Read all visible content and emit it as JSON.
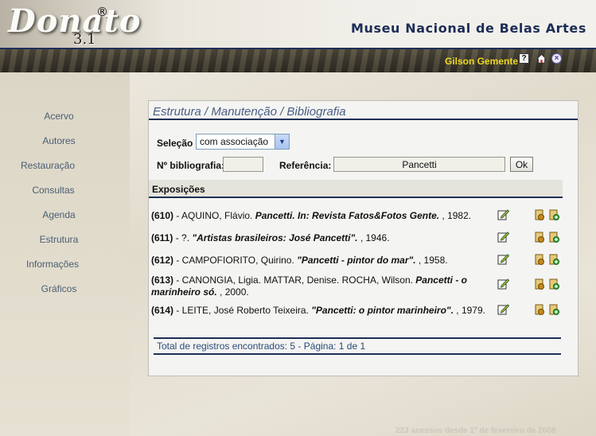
{
  "header": {
    "logo": "Donato",
    "logo_mark": "®",
    "version": "3.1",
    "museum": "Museu Nacional de Belas Artes",
    "user": "Gilson Gemente",
    "icons": [
      "help-icon",
      "home-icon",
      "close-icon"
    ]
  },
  "sidebar": {
    "items": [
      {
        "label": "Acervo"
      },
      {
        "label": "Autores"
      },
      {
        "label": "Restauração"
      },
      {
        "label": "Consultas"
      },
      {
        "label": "Agenda"
      },
      {
        "label": "Estrutura"
      },
      {
        "label": "Informações"
      },
      {
        "label": "Gráficos"
      }
    ]
  },
  "main": {
    "breadcrumb": "Estrutura / Manutenção / Bibliografia",
    "selection": {
      "label": "Seleção",
      "value": "com associação"
    },
    "filters": {
      "bib_label": "Nº bibliografia:",
      "bib_value": "",
      "ref_label": "Referência:",
      "ref_value": "Pancetti",
      "ok": "Ok"
    },
    "section_title": "Exposições",
    "rows": [
      {
        "id": "(610)",
        "pre": " - AQUINO, Flávio. ",
        "title": "Pancetti. In: Revista Fatos&Fotos Gente.",
        "post": " , 1982."
      },
      {
        "id": "(611)",
        "pre": " - ?. ",
        "title": "\"Artistas brasileiros: José Pancetti\".",
        "post": " , 1946."
      },
      {
        "id": "(612)",
        "pre": " - CAMPOFIORITO, Quirino. ",
        "title": "\"Pancetti - pintor do mar\".",
        "post": " , 1958."
      },
      {
        "id": "(613)",
        "pre": " - CANONGIA, Ligia. MATTAR, Denise. ROCHA, Wilson. ",
        "title": "Pancetti - o marinheiro só.",
        "post": " , 2000."
      },
      {
        "id": "(614)",
        "pre": " - LEITE, José Roberto Teixeira. ",
        "title": "\"Pancetti: o pintor marinheiro\".",
        "post": " , 1979."
      }
    ],
    "row_icons": [
      "edit-icon",
      "associate-icon",
      "add-icon"
    ],
    "total": "Total de registros encontrados: 5 - Página: 1 de 1"
  },
  "footer": {
    "access": "223 acessos desde 1º de fevereiro de 2008"
  }
}
